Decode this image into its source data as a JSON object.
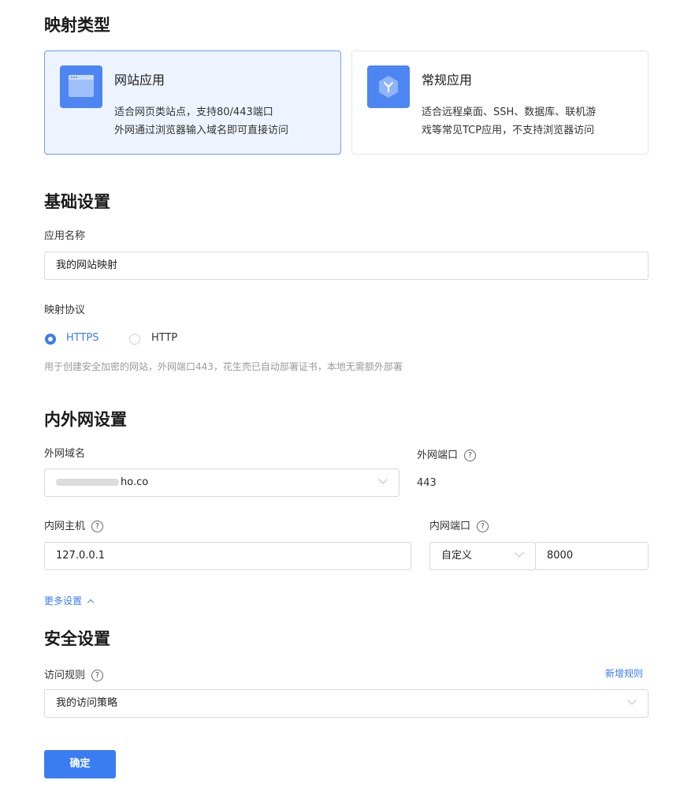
{
  "mapping_type": {
    "title": "映射类型",
    "cards": [
      {
        "title": "网站应用",
        "desc_line1": "适合网页类站点，支持80/443端口",
        "desc_line2": "外网通过浏览器输入域名即可直接访问",
        "icon": "browser-window-icon",
        "selected": true
      },
      {
        "title": "常规应用",
        "desc_line1": "适合远程桌面、SSH、数据库、联机游",
        "desc_line2": "戏等常见TCP应用，不支持浏览器访问",
        "icon": "cube-app-icon",
        "selected": false
      }
    ]
  },
  "basic": {
    "title": "基础设置",
    "app_name_label": "应用名称",
    "app_name_value": "我的网站映射",
    "protocol_label": "映射协议",
    "protocol_options": [
      "HTTPS",
      "HTTP"
    ],
    "protocol_selected": "HTTPS",
    "protocol_hint": "用于创建安全加密的网站，外网端口443，花生壳已自动部署证书，本地无需额外部署"
  },
  "network": {
    "title": "内外网设置",
    "domain_label": "外网域名",
    "domain_value_visible": "ho.co",
    "ext_port_label": "外网端口",
    "ext_port_value": "443",
    "host_label": "内网主机",
    "host_value": "127.0.0.1",
    "int_port_label": "内网端口",
    "int_port_mode": "自定义",
    "int_port_value": "8000",
    "more_settings": "更多设置"
  },
  "security": {
    "title": "安全设置",
    "rule_label": "访问规则",
    "add_rule": "新增规则",
    "rule_value": "我的访问策略"
  },
  "submit_label": "确定",
  "colors": {
    "accent": "#3a7cf2",
    "selected_card_bg": "#eef4ff"
  }
}
